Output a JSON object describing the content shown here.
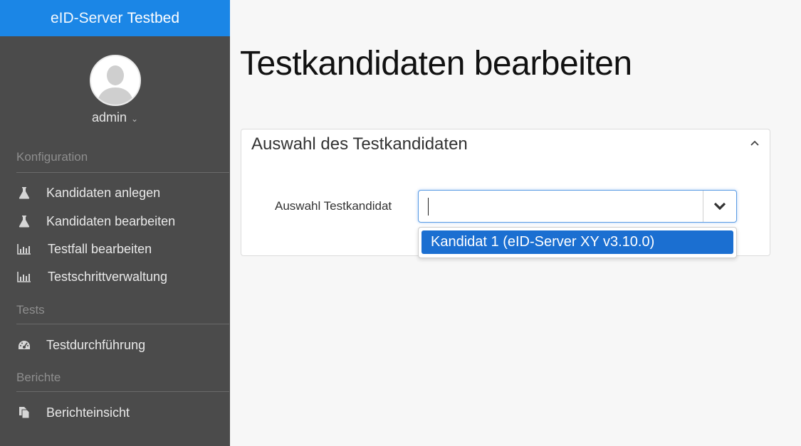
{
  "sidebar": {
    "brand": {
      "light": "eID-Server",
      "bold": "Testbed"
    },
    "user": {
      "name": "admin"
    },
    "sections": [
      {
        "title": "Konfiguration",
        "items": [
          {
            "label": "Kandidaten anlegen",
            "icon": "flask-icon"
          },
          {
            "label": "Kandidaten bearbeiten",
            "icon": "flask-icon"
          },
          {
            "label": "Testfall bearbeiten",
            "icon": "bar-chart-icon"
          },
          {
            "label": "Testschrittverwaltung",
            "icon": "bar-chart-icon"
          }
        ]
      },
      {
        "title": "Tests",
        "items": [
          {
            "label": "Testdurchführung",
            "icon": "dashboard-icon"
          }
        ]
      },
      {
        "title": "Berichte",
        "items": [
          {
            "label": "Berichteinsicht",
            "icon": "copy-icon"
          }
        ]
      }
    ]
  },
  "main": {
    "title": "Testkandidaten bearbeiten",
    "panel": {
      "title": "Auswahl des Testkandidaten",
      "field_label": "Auswahl Testkandidat",
      "select": {
        "value": "",
        "options": [
          "Kandidat 1 (eID-Server XY v3.10.0)"
        ]
      }
    }
  },
  "colors": {
    "brand": "#1b86e6",
    "sidebar_bg": "#4b4b4b",
    "option_highlight": "#1b6fd1"
  }
}
